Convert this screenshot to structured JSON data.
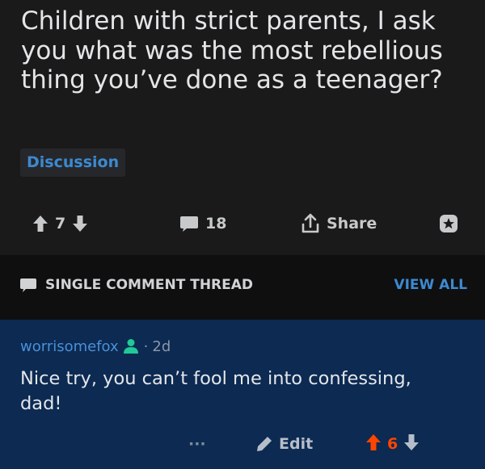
{
  "post": {
    "title": "Children with strict parents, I ask you what was the most rebellious thing you’ve done as a teenager?",
    "flair": "Discussion",
    "votes": "7",
    "comments": "18",
    "share_label": "Share"
  },
  "thread": {
    "label": "SINGLE COMMENT THREAD",
    "view_all": "VIEW ALL"
  },
  "comment": {
    "author": "worrisomefox",
    "separator": "·",
    "age": "2d",
    "body": "Nice try, you can’t fool me into confessing, dad!",
    "more": "···",
    "edit_label": "Edit",
    "votes": "6"
  },
  "colors": {
    "background": "#1a1a1b",
    "thread_bar": "#0f0f10",
    "comment_highlight": "#0c2a52",
    "link_blue": "#3d8ad1",
    "upvote_orange": "#ff4500",
    "text": "#e4e5e6"
  },
  "icons": {
    "upvote": "arrow-up-icon",
    "downvote": "arrow-down-icon",
    "comments": "speech-bubble-icon",
    "share": "share-icon",
    "award": "award-icon",
    "thread": "speech-bubble-icon",
    "user": "user-icon",
    "edit": "pencil-icon"
  }
}
